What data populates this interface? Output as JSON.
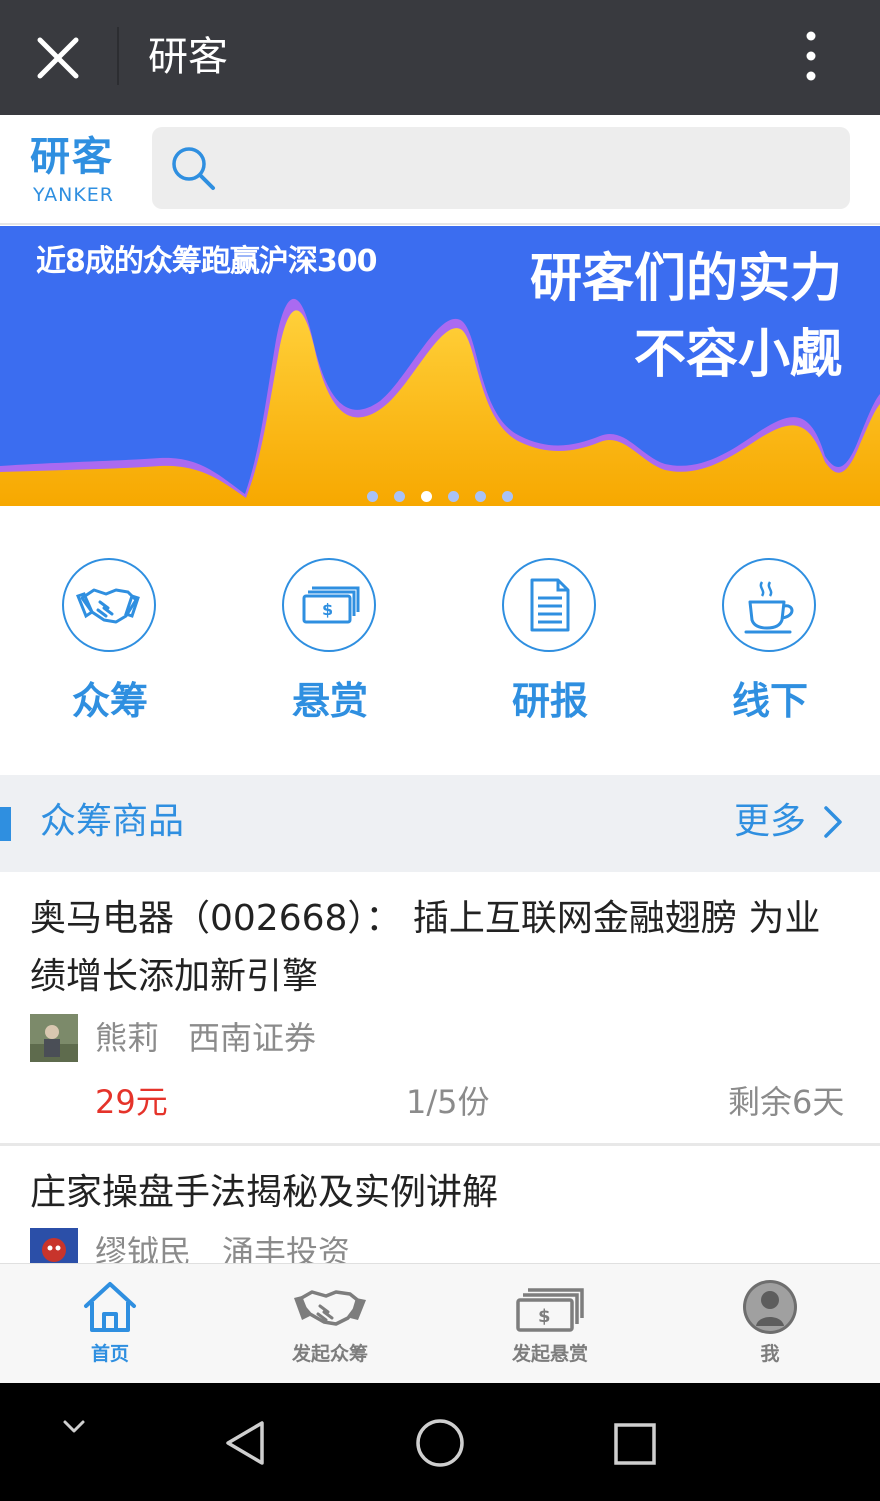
{
  "window": {
    "title": "研客",
    "close_icon": "close-icon",
    "menu_icon": "more-vertical-icon"
  },
  "header": {
    "logo_cn": "研客",
    "logo_en": "YANKER",
    "search_icon": "search-icon"
  },
  "banner": {
    "line1": "近8成的众筹跑赢沪深300",
    "line2": "研客们的实力",
    "line3": "不容小觑",
    "pages": 6,
    "active_page": 3
  },
  "quick_menu": [
    {
      "label": "众筹",
      "icon": "handshake-icon"
    },
    {
      "label": "悬赏",
      "icon": "money-icon"
    },
    {
      "label": "研报",
      "icon": "document-icon"
    },
    {
      "label": "线下",
      "icon": "coffee-cup-icon"
    }
  ],
  "section": {
    "title": "众筹商品",
    "more": "更多"
  },
  "items": [
    {
      "title": "奥马电器（002668）： 插上互联网金融翅膀 为业绩增长添加新引擎",
      "author": "熊莉",
      "org": "西南证券",
      "price": "29元",
      "parts": "1/5份",
      "remain": "剩余6天"
    },
    {
      "title": "庄家操盘手法揭秘及实例讲解",
      "author": "缪钺民",
      "org": "涌丰投资"
    }
  ],
  "bottom_nav": [
    {
      "label": "首页",
      "icon": "home-icon",
      "active": true
    },
    {
      "label": "发起众筹",
      "icon": "handshake-icon",
      "active": false
    },
    {
      "label": "发起悬赏",
      "icon": "money-icon",
      "active": false
    },
    {
      "label": "我",
      "icon": "user-avatar-icon",
      "active": false
    }
  ],
  "colors": {
    "accent": "#2f8fe0",
    "price": "#e5332a",
    "banner_bg": "#3b6df0",
    "topbar": "#393a3f"
  }
}
